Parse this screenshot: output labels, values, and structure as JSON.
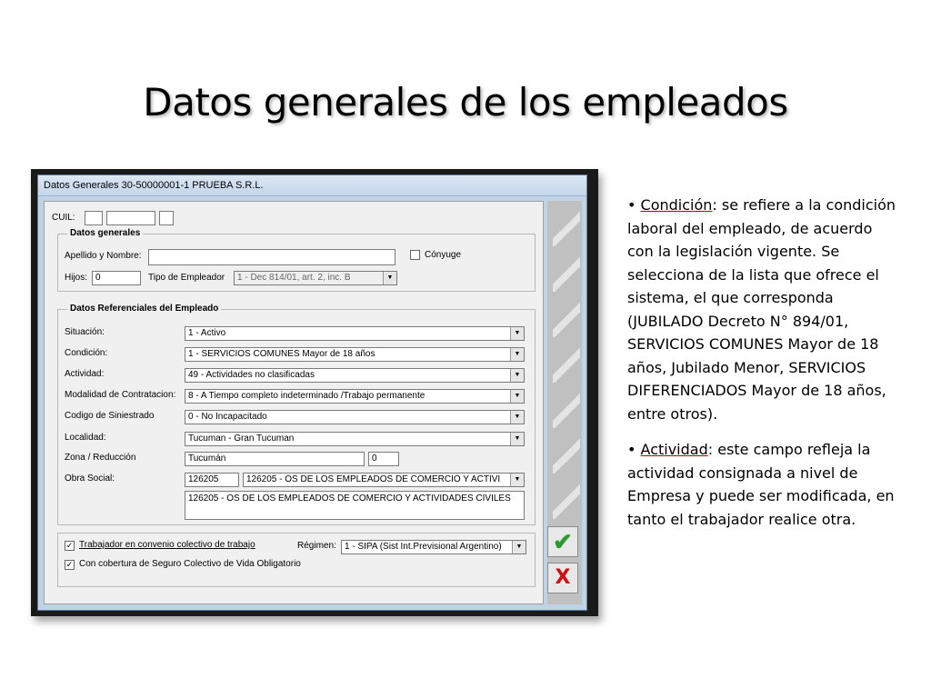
{
  "slide": {
    "title": "Datos generales de los empleados"
  },
  "window": {
    "title": "Datos Generales  30-50000001-1  PRUEBA S.R.L."
  },
  "form": {
    "cuil_label": "CUIL:",
    "datos_generales_title": "Datos generales",
    "apellido_label": "Apellido y Nombre:",
    "apellido_value": "",
    "conyuge_label": "Cónyuge",
    "hijos_label": "Hijos:",
    "hijos_value": "0",
    "tipo_empleador_label": "Tipo de Empleador",
    "tipo_empleador_value": "1 - Dec 814/01, art. 2, inc. B",
    "datos_ref_title": "Datos Referenciales del Empleado",
    "situacion_label": "Situación:",
    "situacion_value": "1 - Activo",
    "condicion_label": "Condición:",
    "condicion_value": "1 - SERVICIOS COMUNES Mayor de 18 años",
    "actividad_label": "Actividad:",
    "actividad_value": "49 - Actividades no clasificadas",
    "modalidad_label": "Modalidad de Contratacion:",
    "modalidad_value": "8 - A Tiempo completo indeterminado /Trabajo permanente",
    "siniestrado_label": "Codigo de Siniestrado",
    "siniestrado_value": "0 - No Incapacitado",
    "localidad_label": "Localidad:",
    "localidad_value": "Tucuman - Gran Tucuman",
    "zona_label": "Zona / Reducción",
    "zona_value": "Tucumán",
    "zona_pct": "0",
    "obra_social_label": "Obra Social:",
    "obra_social_code": "126205",
    "obra_social_value": "126205 - OS  DE LOS EMPLEADOS DE COMERCIO Y ACTIVI",
    "obra_social_memo": "126205 - OS  DE LOS EMPLEADOS DE COMERCIO Y ACTIVIDADES CIVILES",
    "convenio_label": "Trabajador en convenio colectivo de trabajo",
    "regimen_label": "Régimen:",
    "regimen_value": "1 - SIPA (Sist Int.Previsional Argentino)",
    "seguro_label": "Con cobertura de Seguro Colectivo de Vida Obligatorio",
    "check_mark": "✓",
    "ok_glyph": "✔",
    "cancel_glyph": "X"
  },
  "notes": {
    "bullet1_term": "Condición",
    "bullet1_text": ": se refiere a la condición laboral del empleado, de acuerdo con la legislación vigente. Se selecciona de la lista que ofrece el sistema, el que corresponda (JUBILADO Decreto N° 894/01, SERVICIOS COMUNES Mayor de 18 años, Jubilado Menor, SERVICIOS DIFERENCIADOS Mayor de 18 años, entre otros).",
    "bullet2_term": "Actividad",
    "bullet2_text": ": este campo refleja la actividad consignada a nivel de Empresa y puede ser modificada, en tanto el trabajador realice otra.",
    "bullet": "•"
  },
  "colors": {
    "accent_check": "#2f9a2f",
    "accent_cancel": "#d01010",
    "window_frame": "#bfd3e7"
  }
}
